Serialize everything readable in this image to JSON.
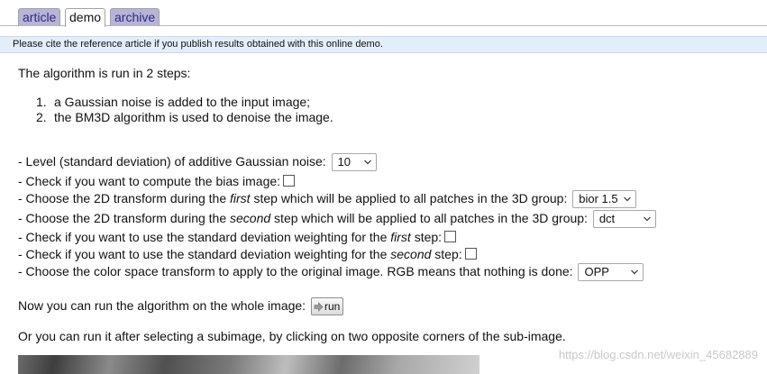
{
  "tabs": [
    {
      "label": "article",
      "active": false
    },
    {
      "label": "demo",
      "active": true
    },
    {
      "label": "archive",
      "active": false
    }
  ],
  "notice": "Please cite the reference article if you publish results obtained with this online demo.",
  "intro": "The algorithm is run in 2 steps:",
  "steps": [
    {
      "num": "1.",
      "text": "a Gaussian noise is added to the input image;"
    },
    {
      "num": "2.",
      "text": "the BM3D algorithm is used to denoise the image."
    }
  ],
  "options": {
    "noise": {
      "label": "- Level (standard deviation) of additive Gaussian noise:",
      "value": "10"
    },
    "bias": {
      "label": "- Check if you want to compute the bias image:",
      "checked": false
    },
    "transform_first": {
      "pre": "- Choose the 2D transform during the ",
      "em": "first",
      "post": " step which will be applied to all patches in the 3D group:",
      "value": "bior 1.5"
    },
    "transform_second": {
      "pre": "- Choose the 2D transform during the ",
      "em": "second",
      "post": " step which will be applied to all patches in the 3D group:",
      "value": "dct"
    },
    "weight_first": {
      "pre": "- Check if you want to use the standard deviation weighting for the ",
      "em": "first",
      "post": " step:",
      "checked": false
    },
    "weight_second": {
      "pre": "- Check if you want to use the standard deviation weighting for the ",
      "em": "second",
      "post": " step:",
      "checked": false
    },
    "color": {
      "label": "- Choose the color space transform to apply to the original image. RGB means that nothing is done:",
      "value": "OPP"
    }
  },
  "run": {
    "label": "Now you can run the algorithm on the whole image:",
    "button": "run"
  },
  "subimage_text": "Or you can run it after selecting a subimage, by clicking on two opposite corners of the sub-image.",
  "watermark": "https://blog.csdn.net/weixin_45682889"
}
